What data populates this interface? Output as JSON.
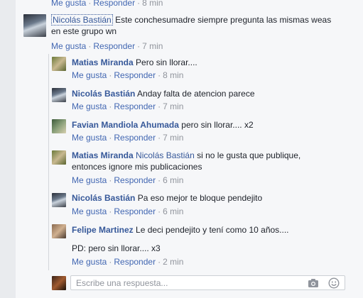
{
  "top_actions": {
    "like": "Me gusta",
    "reply": "Responder",
    "sep": "·",
    "time": "8 min"
  },
  "main_comment": {
    "author": "Nicolás Bastián",
    "text_line1": "Este conchesumadre siempre pregunta las mismas weas",
    "text_line2": "en este grupo wn",
    "actions": {
      "like": "Me gusta",
      "reply": "Responder",
      "sep": "·",
      "time": "7 min"
    }
  },
  "replies": [
    {
      "author": "Matias Miranda",
      "text": "Pero sin llorar....",
      "like": "Me gusta",
      "reply": "Responder",
      "sep": "·",
      "time": "8 min"
    },
    {
      "author": "Nicolás Bastián",
      "text": "Anday falta de atencion parece",
      "like": "Me gusta",
      "reply": "Responder",
      "sep": "·",
      "time": "7 min"
    },
    {
      "author": "Favian Mandiola Ahumada",
      "text": "pero sin llorar.... x2",
      "like": "Me gusta",
      "reply": "Responder",
      "sep": "·",
      "time": "7 min"
    },
    {
      "author": "Matias Miranda",
      "mention": "Nicolás Bastián",
      "text_line1": "si no le gusta que publique,",
      "text_line2": "entonces ignore mis publicaciones",
      "like": "Me gusta",
      "reply": "Responder",
      "sep": "·",
      "time": "6 min"
    },
    {
      "author": "Nicolás Bastián",
      "text": "Pa eso mejor te bloque pendejito",
      "like": "Me gusta",
      "reply": "Responder",
      "sep": "·",
      "time": "6 min"
    },
    {
      "author": "Felipe Martinez",
      "text": "Le deci pendejito y tení como 10 años....",
      "text_line2": "PD: pero sin llorar.... x3",
      "like": "Me gusta",
      "reply": "Responder",
      "sep": "·",
      "time": "2 min"
    }
  ],
  "reply_input": {
    "placeholder": "Escribe una respuesta..."
  },
  "icons": {
    "camera": "camera-icon",
    "emoji": "emoji-icon"
  },
  "colors": {
    "link": "#365899",
    "action": "#4267b2",
    "muted": "#90949c",
    "background": "#f6f7f9"
  }
}
